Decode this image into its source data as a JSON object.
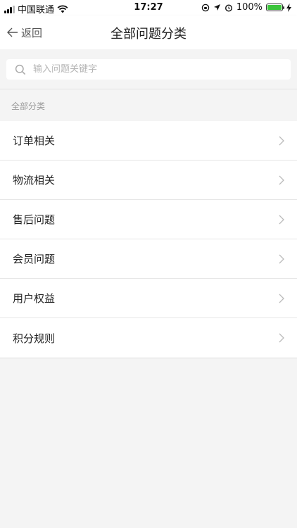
{
  "status_bar": {
    "carrier": "中国联通",
    "time": "17:27",
    "battery": "100%",
    "battery_level": 1.0
  },
  "header": {
    "back_label": "返回",
    "title": "全部问题分类"
  },
  "search": {
    "placeholder": "输入问题关键字"
  },
  "section": {
    "label": "全部分类"
  },
  "categories": [
    {
      "label": "订单相关"
    },
    {
      "label": "物流相关"
    },
    {
      "label": "售后问题"
    },
    {
      "label": "会员问题"
    },
    {
      "label": "用户权益"
    },
    {
      "label": "积分规则"
    }
  ],
  "icons": {
    "back": "arrow-left-icon",
    "search": "search-icon",
    "chevron": "chevron-right-icon",
    "wifi": "wifi-icon",
    "signal": "signal-icon",
    "battery": "battery-icon"
  },
  "colors": {
    "background": "#f4f4f4",
    "surface": "#ffffff",
    "battery_fill": "#3bc43b"
  }
}
